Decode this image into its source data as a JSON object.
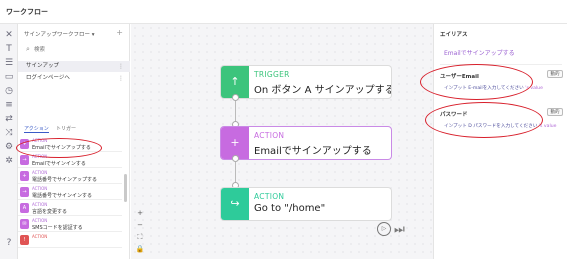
{
  "topbar": {
    "title": "ワークフロー"
  },
  "rail_icons": [
    "close-icon",
    "text-icon",
    "list-icon",
    "display-icon",
    "clock-icon",
    "database-icon",
    "flow-icon",
    "shuffle-icon",
    "settings-icon",
    "gear-icon",
    "help-icon"
  ],
  "left": {
    "workflow_title": "サインアップワークフロー ▾",
    "add": "+",
    "search_placeholder": "検索",
    "workflows": [
      {
        "label": "サインアップ",
        "menu": "⋮"
      },
      {
        "label": "ログインページへ",
        "menu": "⋮"
      }
    ],
    "tabs": {
      "action": "アクション",
      "trigger": "トリガー"
    },
    "actions": [
      {
        "kind": "ACTION",
        "name": "Emailでサインアップする",
        "color": "#c76be0"
      },
      {
        "kind": "ACTION",
        "name": "Emailでサインインする",
        "color": "#c76be0"
      },
      {
        "kind": "ACTION",
        "name": "電話番号でサインアップする",
        "color": "#c76be0"
      },
      {
        "kind": "ACTION",
        "name": "電話番号でサインインする",
        "color": "#c76be0"
      },
      {
        "kind": "ACTION",
        "name": "言語を変更する",
        "color": "#c76be0"
      },
      {
        "kind": "ACTION",
        "name": "SMSコードを認証する",
        "color": "#c76be0"
      },
      {
        "kind": "ACTION",
        "name": "",
        "color": "#e05454"
      }
    ]
  },
  "canvas": {
    "nodes": [
      {
        "kind": "TRIGGER",
        "text": "On ボタン A サインアップする click",
        "color": "#3cc47c",
        "glyph": "↑"
      },
      {
        "kind": "ACTION",
        "text": "Emailでサインアップする",
        "color": "#c76be0",
        "glyph": "+"
      },
      {
        "kind": "ACTION",
        "text": "Go to \"/home\"",
        "color": "#2ecb9a",
        "glyph": "↪"
      }
    ],
    "zoom": [
      "+",
      "−",
      "⛶",
      "🔒"
    ],
    "play": "▷",
    "skip": "⏭"
  },
  "right": {
    "heading": "エイリアス",
    "description": "Emailでサインアップする",
    "fields": [
      {
        "label": "ユーザーEmail",
        "button": "動的",
        "value_prefix": "インプット E-mailを入力してください",
        "value_suffix": "'s value"
      },
      {
        "label": "パスワード",
        "button": "動的",
        "value_prefix": "インプット D パスワードを入力してください",
        "value_suffix": "'s value"
      }
    ]
  },
  "colors": {
    "accent": "#3a5bc7",
    "action": "#c76be0",
    "trigger": "#3cc47c",
    "annotation": "#d8202c"
  }
}
